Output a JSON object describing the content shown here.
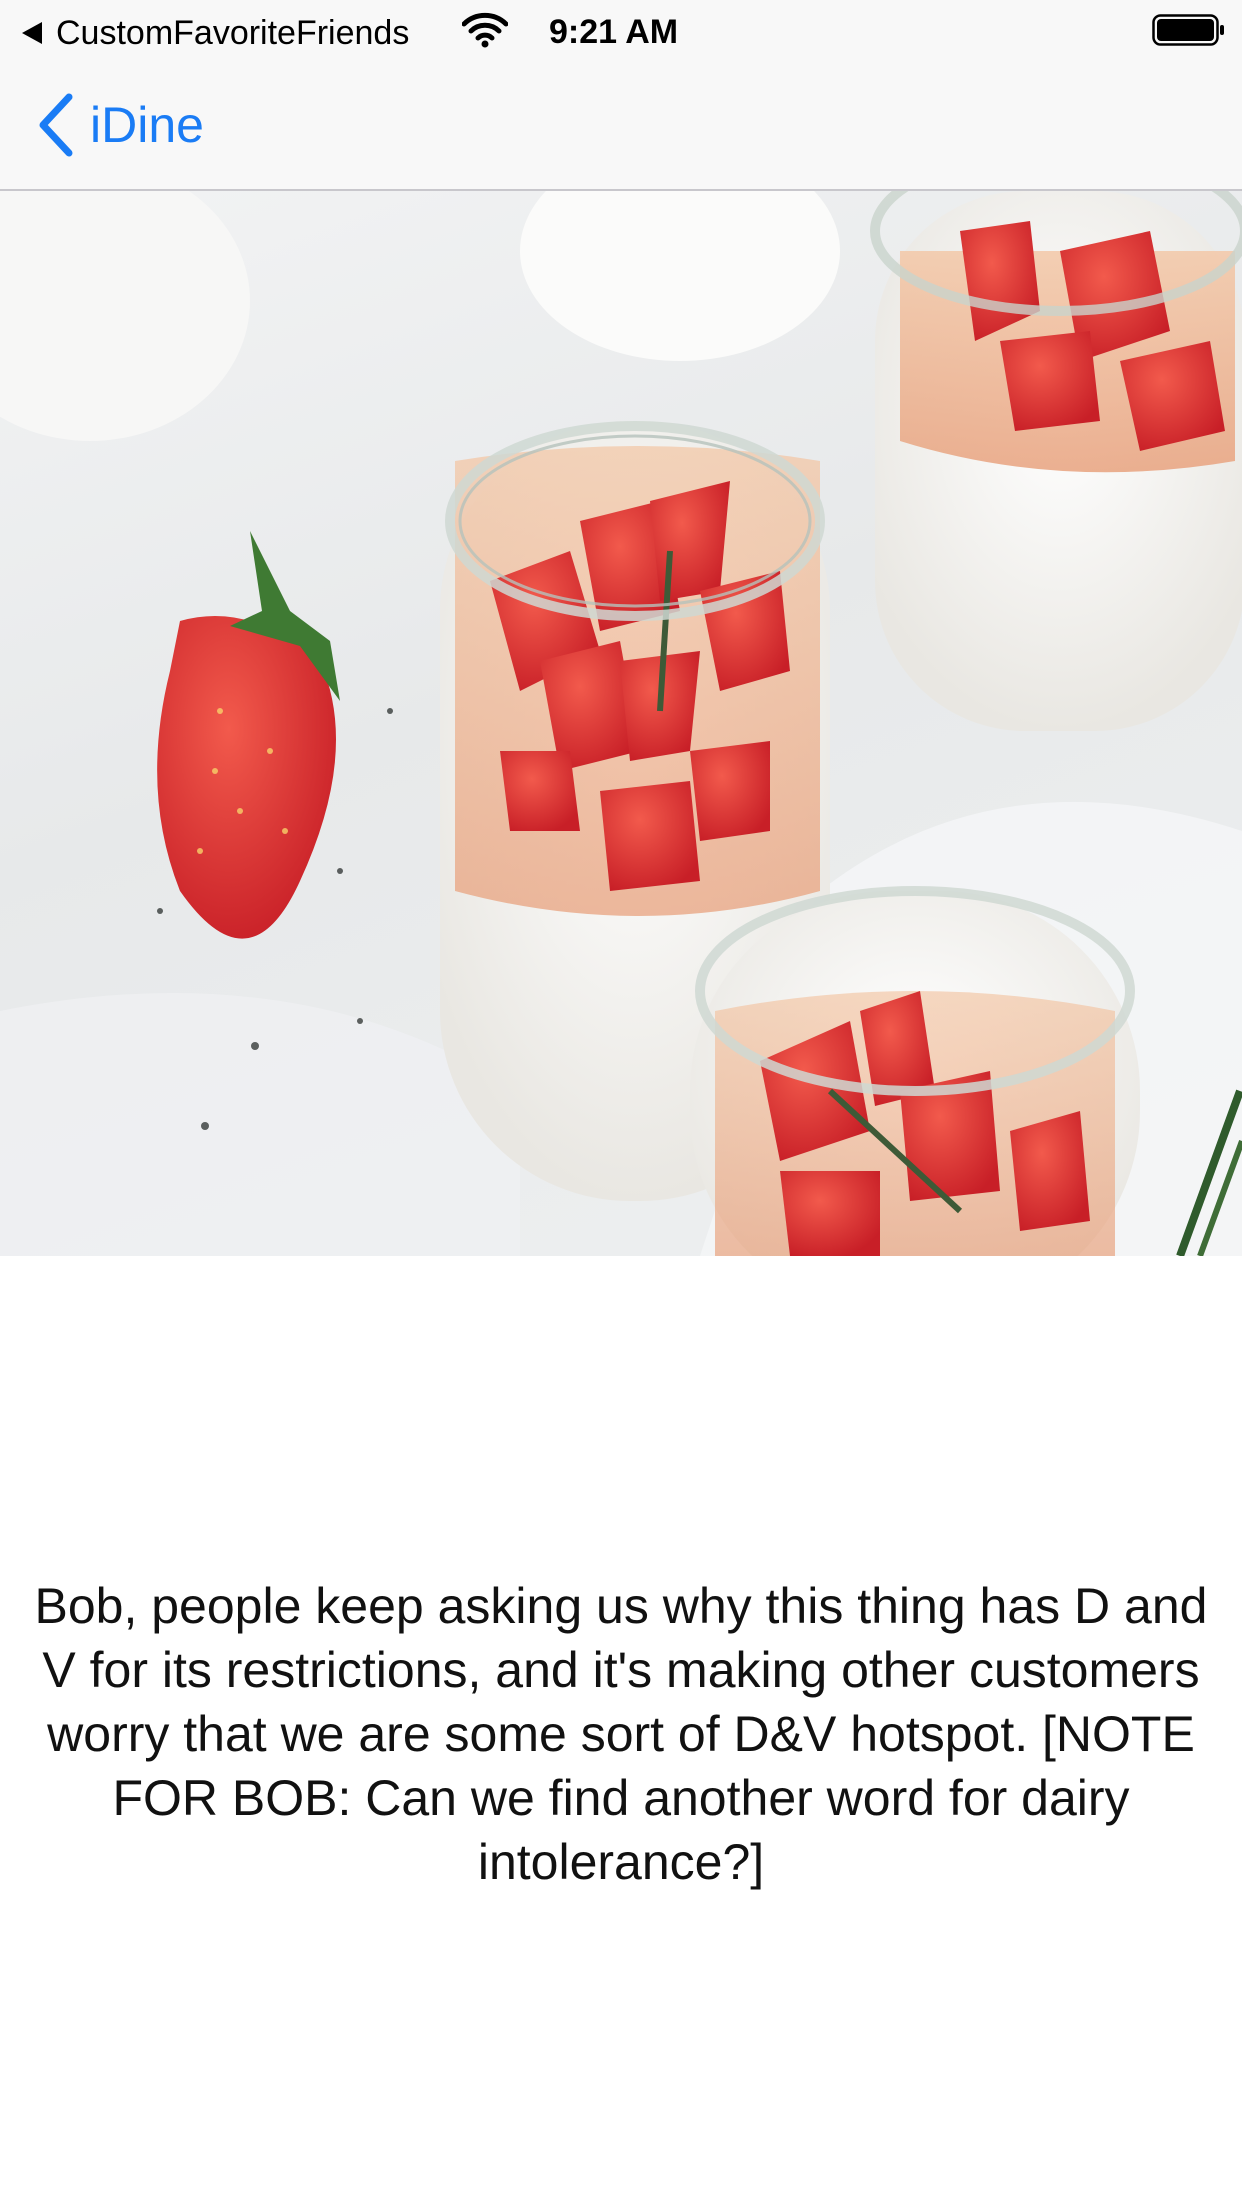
{
  "status_bar": {
    "back_app": "CustomFavoriteFriends",
    "time": "9:21 AM",
    "icons": [
      "back-arrow-icon",
      "wifi-icon",
      "battery-icon"
    ]
  },
  "nav_bar": {
    "back_label": "iDine",
    "back_icon": "chevron-left-icon",
    "accent_color": "#1a7cf5"
  },
  "hero": {
    "image_subject": "strawberry panna cotta jars"
  },
  "item": {
    "description": "Bob, people keep asking us why this thing has D and V for its restrictions, and it's making other customers worry that we are some sort of D&V hotspot. [NOTE FOR BOB: Can we find another word for dairy intolerance?]"
  }
}
